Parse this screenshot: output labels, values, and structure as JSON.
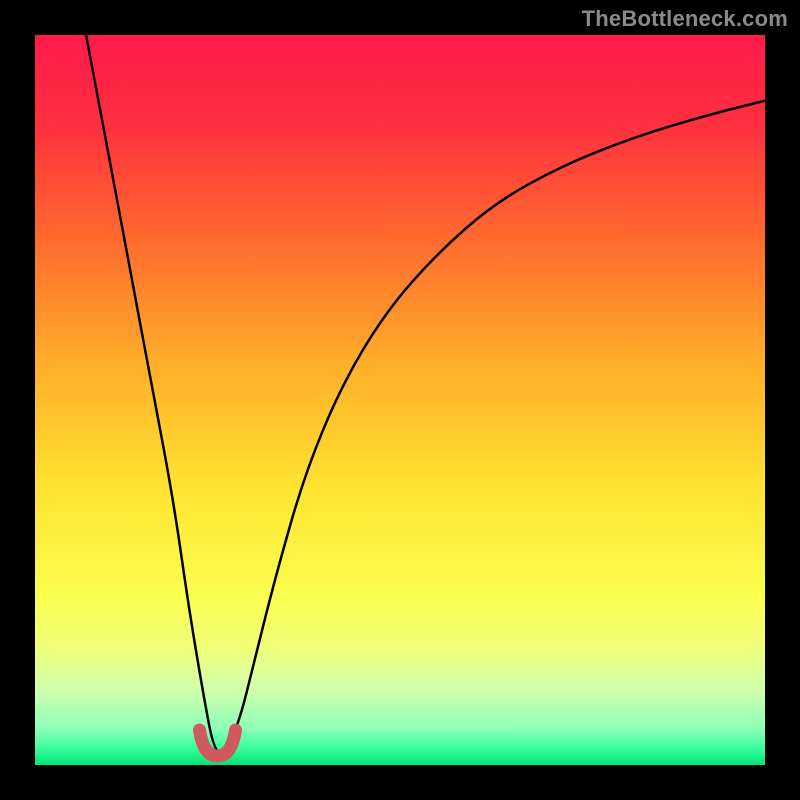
{
  "watermark": {
    "text": "TheBottleneck.com"
  },
  "chart_data": {
    "type": "line",
    "title": "",
    "xlabel": "",
    "ylabel": "",
    "xlim": [
      0,
      100
    ],
    "ylim": [
      0,
      100
    ],
    "grid": false,
    "legend": false,
    "series": [
      {
        "name": "bottleneck-curve",
        "x": [
          7,
          10,
          13,
          16,
          19,
          21,
          23,
          24.5,
          26,
          28,
          30,
          33,
          37,
          42,
          48,
          55,
          63,
          72,
          82,
          92,
          100
        ],
        "values": [
          100,
          84,
          68,
          52,
          36,
          22,
          10,
          2,
          1.5,
          6,
          14,
          26,
          40,
          52,
          62,
          70,
          77,
          82,
          86,
          89,
          91
        ]
      }
    ],
    "minimum_marker": {
      "x": 25,
      "y": 1.5,
      "color": "#ce5a5f"
    },
    "background_gradient": {
      "stops": [
        {
          "offset": 0.0,
          "color": "#ff1a4b"
        },
        {
          "offset": 0.12,
          "color": "#ff2f3f"
        },
        {
          "offset": 0.28,
          "color": "#ff6a2e"
        },
        {
          "offset": 0.45,
          "color": "#ffae2a"
        },
        {
          "offset": 0.62,
          "color": "#ffe331"
        },
        {
          "offset": 0.77,
          "color": "#faff4f"
        },
        {
          "offset": 0.84,
          "color": "#f0ff7a"
        },
        {
          "offset": 0.9,
          "color": "#cfffae"
        },
        {
          "offset": 0.95,
          "color": "#8cffb8"
        },
        {
          "offset": 0.975,
          "color": "#3fff9e"
        },
        {
          "offset": 1.0,
          "color": "#00e477"
        }
      ]
    }
  }
}
